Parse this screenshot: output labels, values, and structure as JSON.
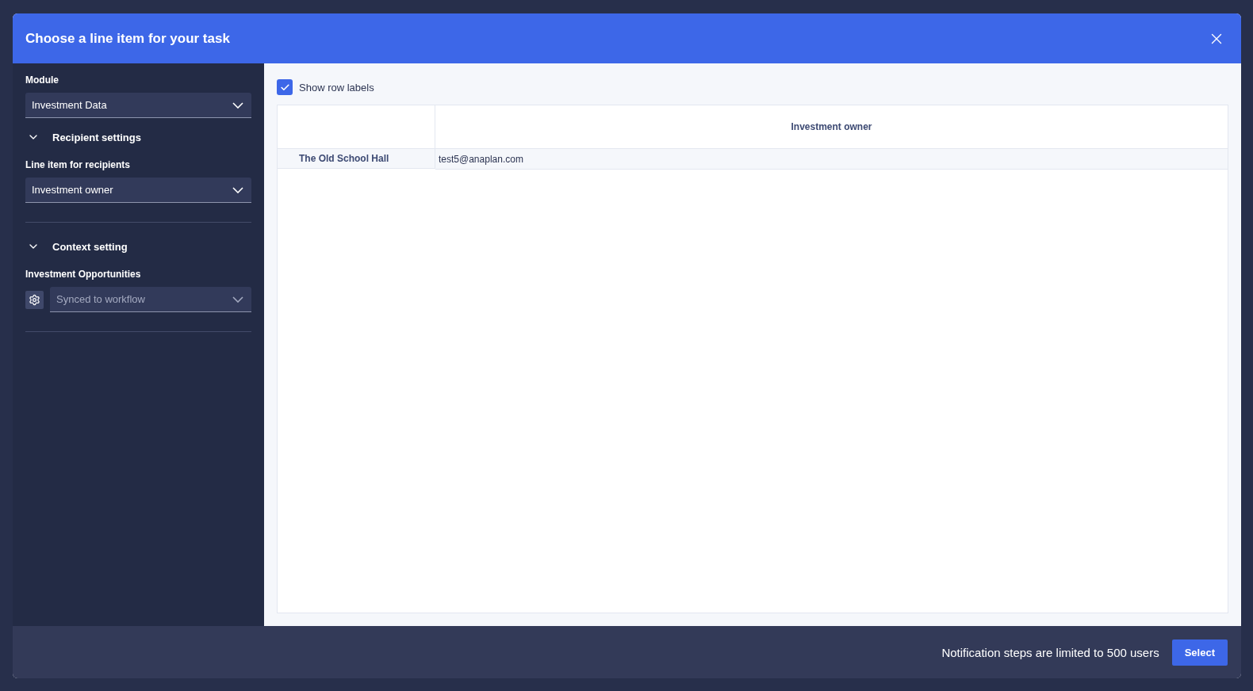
{
  "dialog": {
    "title": "Choose a line item for your task"
  },
  "sidebar": {
    "module": {
      "label": "Module",
      "value": "Investment Data"
    },
    "sections": [
      {
        "title": "Recipient settings",
        "expanded": true,
        "fields": [
          {
            "kind": "select",
            "label": "Line item for recipients",
            "value": "Investment owner"
          }
        ]
      },
      {
        "title": "Context setting",
        "expanded": true,
        "fields": [
          {
            "kind": "synced",
            "label": "Investment Opportunities",
            "value": "Synced to workflow"
          }
        ]
      }
    ]
  },
  "grid": {
    "show_row_labels": {
      "label": "Show row labels",
      "checked": true
    },
    "columns": [
      "Investment owner"
    ],
    "rows": [
      {
        "label": "The Old School Hall",
        "cells": [
          "test5@anaplan.com"
        ]
      }
    ]
  },
  "footer": {
    "note": "Notification steps are limited to 500 users",
    "button": "Select"
  }
}
